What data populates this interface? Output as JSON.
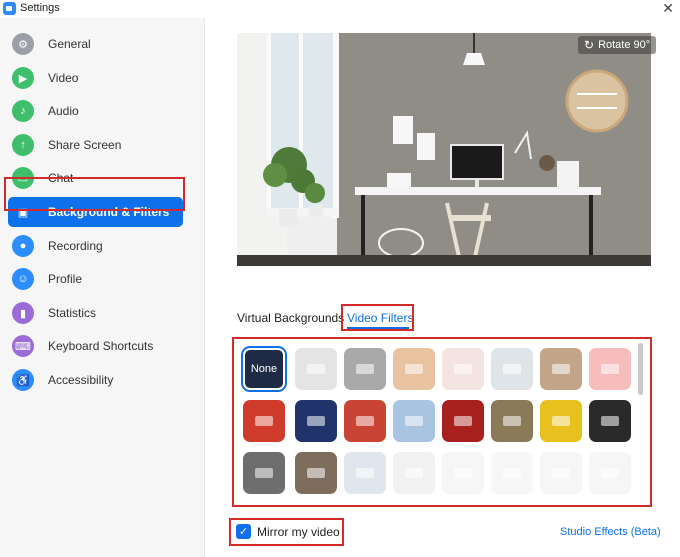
{
  "window": {
    "title": "Settings",
    "close_glyph": "✕"
  },
  "sidebar": {
    "items": [
      {
        "label": "General",
        "icon": "gear-icon",
        "color": "#9aa0a6",
        "glyph": "⚙"
      },
      {
        "label": "Video",
        "icon": "video-icon",
        "color": "#3fbf6b",
        "glyph": "▶"
      },
      {
        "label": "Audio",
        "icon": "headphones-icon",
        "color": "#3fbf6b",
        "glyph": "♪"
      },
      {
        "label": "Share Screen",
        "icon": "share-screen-icon",
        "color": "#3fbf6b",
        "glyph": "↑"
      },
      {
        "label": "Chat",
        "icon": "chat-icon",
        "color": "#3fbf6b",
        "glyph": "▭"
      },
      {
        "label": "Background & Filters",
        "icon": "background-icon",
        "color": "#0E71EB",
        "glyph": "▣",
        "active": true
      },
      {
        "label": "Recording",
        "icon": "record-icon",
        "color": "#2D8CFF",
        "glyph": "●"
      },
      {
        "label": "Profile",
        "icon": "profile-icon",
        "color": "#2D8CFF",
        "glyph": "☺"
      },
      {
        "label": "Statistics",
        "icon": "statistics-icon",
        "color": "#9b6cd8",
        "glyph": "▮"
      },
      {
        "label": "Keyboard Shortcuts",
        "icon": "keyboard-icon",
        "color": "#9b6cd8",
        "glyph": "⌨"
      },
      {
        "label": "Accessibility",
        "icon": "accessibility-icon",
        "color": "#2D8CFF",
        "glyph": "♿"
      }
    ]
  },
  "preview": {
    "rotate_label": "Rotate 90°",
    "rotate_glyph": "↻"
  },
  "tabs": {
    "virtual_backgrounds": "Virtual Backgrounds",
    "video_filters": "Video Filters"
  },
  "filters": {
    "none_label": "None",
    "tiles": [
      {
        "name": "none-filter-tile"
      },
      {
        "name": "filter-light-gray",
        "bg": "#e4e4e4"
      },
      {
        "name": "filter-gray",
        "bg": "#a9a9a9"
      },
      {
        "name": "filter-warm",
        "bg": "#e9c3a0"
      },
      {
        "name": "filter-blush",
        "bg": "#f3e4e2"
      },
      {
        "name": "filter-cool-light",
        "bg": "#dfe4e8"
      },
      {
        "name": "filter-sepia",
        "bg": "#c3a68a"
      },
      {
        "name": "filter-pink",
        "bg": "#f7bcbc"
      },
      {
        "name": "frame-video-recording",
        "bg": "#d13b2b"
      },
      {
        "name": "frame-string-lights",
        "bg": "#20346b"
      },
      {
        "name": "frame-christmas-wreath",
        "bg": "#c94434"
      },
      {
        "name": "frame-snowy-house",
        "bg": "#a9c4e0"
      },
      {
        "name": "frame-theater-curtain",
        "bg": "#a8201e"
      },
      {
        "name": "frame-retro-tv",
        "bg": "#8a7a58"
      },
      {
        "name": "frame-smiley-faces",
        "bg": "#e8c11e"
      },
      {
        "name": "frame-film-strip",
        "bg": "#2a2a2a"
      },
      {
        "name": "frame-camera-focus",
        "bg": "#6e6e6e"
      },
      {
        "name": "frame-old-tv",
        "bg": "#7e6d5c"
      },
      {
        "name": "sticker-award-ribbon",
        "bg": "#dfe6ee"
      },
      {
        "name": "sticker-huh-bubble",
        "bg": "#f1f1f1"
      },
      {
        "name": "sticker-santa-hat",
        "bg": "#f6f6f6"
      },
      {
        "name": "sticker-reindeer-antlers",
        "bg": "#f6f6f6"
      },
      {
        "name": "sticker-beanie",
        "bg": "#f6f6f6"
      },
      {
        "name": "sticker-pixel-sunglasses",
        "bg": "#f6f6f6"
      }
    ]
  },
  "bottom": {
    "mirror_label": "Mirror my video",
    "mirror_checked": true,
    "check_glyph": "✓",
    "studio_effects": "Studio Effects (Beta)"
  }
}
